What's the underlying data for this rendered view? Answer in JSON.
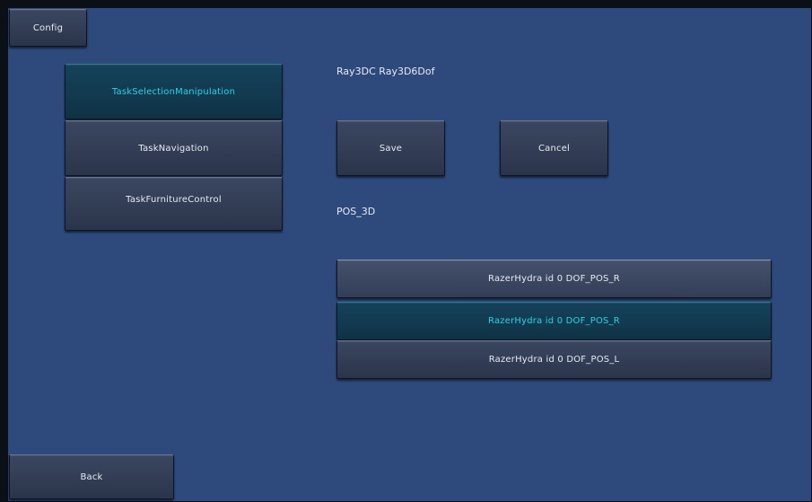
{
  "header": {
    "config_label": "Config"
  },
  "tasks": [
    {
      "label": "TaskSelectionManipulation",
      "active": true
    },
    {
      "label": "TaskNavigation",
      "active": false
    },
    {
      "label": "TaskFurnitureControl",
      "active": false
    }
  ],
  "device_title": "Ray3DC Ray3D6Dof",
  "actions": {
    "save_label": "Save",
    "cancel_label": "Cancel"
  },
  "dof_label": "POS_3D",
  "inputs": [
    {
      "label": "RazerHydra id 0 DOF_POS_R",
      "active": false
    },
    {
      "label": "RazerHydra id 0 DOF_POS_R",
      "active": true
    },
    {
      "label": "RazerHydra id 0 DOF_POS_L",
      "active": false
    }
  ],
  "footer": {
    "back_label": "Back"
  },
  "colors": {
    "background": "#2e4a7d",
    "active_text": "#29d3e3",
    "button": "#323d55"
  }
}
